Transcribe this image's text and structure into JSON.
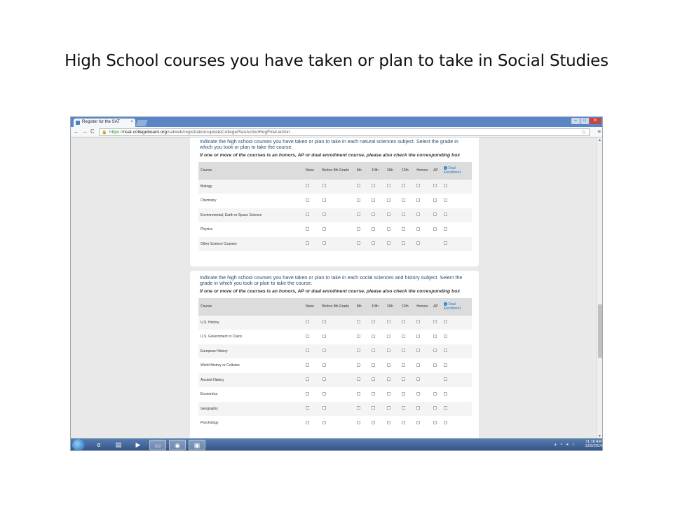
{
  "slide": {
    "title": "High School courses you have taken or plan to take in Social Studies"
  },
  "browser": {
    "tab_title": "Register for the SAT",
    "tab_close": "×",
    "url_scheme": "https://",
    "url_host": "nsat.collegeboard.org",
    "url_path": "/satweb/registration/updateCollegePlanActionRegFlow.action",
    "back": "←",
    "forward": "→",
    "reload": "C",
    "star": "☆",
    "menu": "≡",
    "win_min": "–",
    "win_max": "□",
    "win_close": "✕"
  },
  "columns": [
    "Course",
    "None",
    "Before 9th Grade",
    "9th",
    "10th",
    "11th",
    "12th",
    "Honors",
    "AP",
    "Dual Enrollment"
  ],
  "science": {
    "question": "Indicate the high school courses you have taken or plan to take in each natural sciences subject. Select the grade in which you took or plan to take the course.",
    "note": "If one or more of the courses is an honors, AP or dual enrollment course, please also check the corresponding box",
    "rows": [
      {
        "course": "Biology",
        "has_ap": true
      },
      {
        "course": "Chemistry",
        "has_ap": true
      },
      {
        "course": "Environmental, Earth or Space Science",
        "has_ap": true
      },
      {
        "course": "Physics",
        "has_ap": true
      },
      {
        "course": "Other Science Courses",
        "has_ap": false
      }
    ]
  },
  "social": {
    "question": "Indicate the high school courses you have taken or plan to take in each social sciences and history subject. Select the grade in which you took or plan to take the course.",
    "note": "If one or more of the courses is an honors, AP or dual enrollment course, please also check the corresponding box",
    "rows": [
      {
        "course": "U.S. History",
        "has_ap": true
      },
      {
        "course": "U.S. Government or Civics",
        "has_ap": true
      },
      {
        "course": "European History",
        "has_ap": true
      },
      {
        "course": "World History or Cultures",
        "has_ap": true
      },
      {
        "course": "Ancient History",
        "has_ap": false
      },
      {
        "course": "Economics",
        "has_ap": true
      },
      {
        "course": "Geography",
        "has_ap": true
      },
      {
        "course": "Psychology",
        "has_ap": true
      }
    ]
  },
  "taskbar": {
    "time": "11:18 AM",
    "date": "12/5/2014"
  }
}
